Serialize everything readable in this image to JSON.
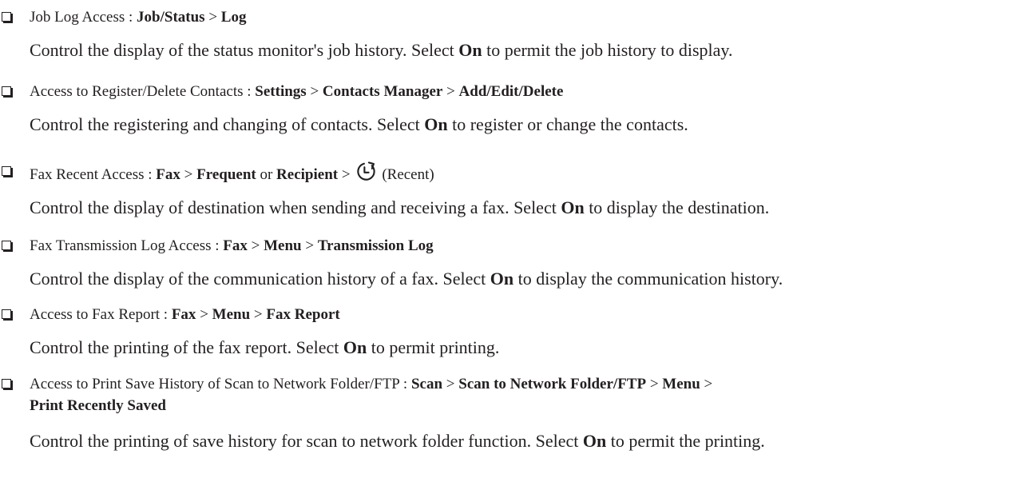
{
  "items": [
    {
      "head_plain": "Job Log Access : ",
      "path": [
        {
          "b": "Job/Status"
        },
        {
          "t": " > "
        },
        {
          "b": "Log"
        }
      ],
      "desc_pre": "Control the display of the status monitor's job history. Select ",
      "desc_bold": "On",
      "desc_post": " to permit the job history to display."
    },
    {
      "head_plain": "Access to Register/Delete Contacts : ",
      "path": [
        {
          "b": "Settings"
        },
        {
          "t": " > "
        },
        {
          "b": "Contacts Manager"
        },
        {
          "t": " > "
        },
        {
          "b": "Add/Edit/Delete"
        }
      ],
      "desc_pre": "Control the registering and changing of contacts. Select ",
      "desc_bold": "On",
      "desc_post": " to register or change the contacts."
    },
    {
      "head_plain": "Fax Recent Access : ",
      "path": [
        {
          "b": "Fax"
        },
        {
          "t": " > "
        },
        {
          "b": "Frequent"
        },
        {
          "t": " or "
        },
        {
          "b": "Recipient"
        },
        {
          "t": " > "
        },
        {
          "icon": "recent-clock-icon"
        },
        {
          "t": "(Recent)"
        }
      ],
      "desc_pre": "Control the display of destination when sending and receiving a fax. Select ",
      "desc_bold": "On",
      "desc_post": " to display the destination."
    },
    {
      "head_plain": "Fax Transmission Log Access : ",
      "path": [
        {
          "b": "Fax"
        },
        {
          "t": " > "
        },
        {
          "b": "Menu"
        },
        {
          "t": " > "
        },
        {
          "b": "Transmission Log"
        }
      ],
      "desc_pre": "Control the display of the communication history of a fax. Select ",
      "desc_bold": "On",
      "desc_post": " to display the communication history."
    },
    {
      "head_plain": "Access to Fax Report : ",
      "path": [
        {
          "b": "Fax"
        },
        {
          "t": " > "
        },
        {
          "b": "Menu"
        },
        {
          "t": " > "
        },
        {
          "b": "Fax Report"
        }
      ],
      "desc_pre": "Control the printing of the fax report. Select ",
      "desc_bold": "On",
      "desc_post": " to permit printing."
    },
    {
      "head_plain": "Access to Print Save History of Scan to Network Folder/FTP : ",
      "path": [
        {
          "b": "Scan"
        },
        {
          "t": " > "
        },
        {
          "b": "Scan to Network Folder/FTP"
        },
        {
          "t": " > "
        },
        {
          "b": "Menu"
        },
        {
          "t": " > "
        },
        {
          "b": "Print Recently Saved"
        }
      ],
      "desc_pre": "Control the printing of save history for scan to network folder function. Select ",
      "desc_bold": "On",
      "desc_post": " to permit the printing."
    }
  ]
}
